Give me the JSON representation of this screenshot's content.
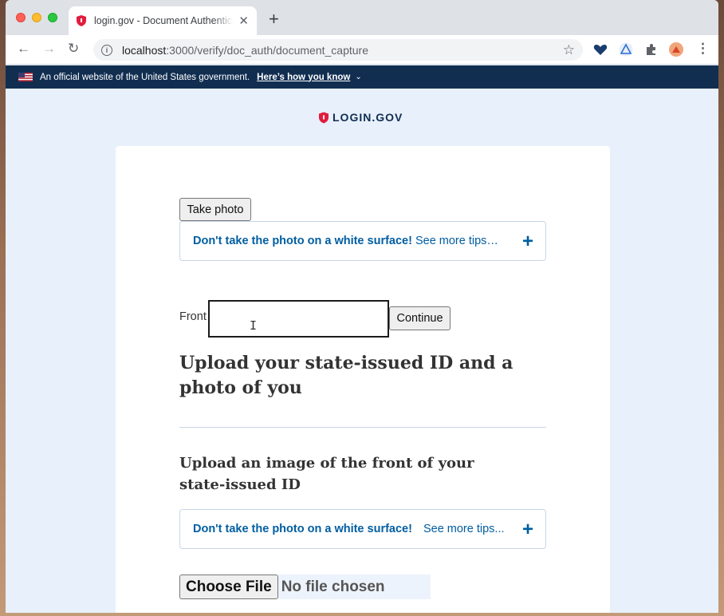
{
  "browser": {
    "tab_title": "login.gov - Document Authentication",
    "url_host": "localhost",
    "url_rest": ":3000/verify/doc_auth/document_capture"
  },
  "banner": {
    "text": "An official website of the United States government.",
    "link": "Here’s how you know"
  },
  "logo": {
    "text": "LOGIN.GOV"
  },
  "main": {
    "take_photo_label": "Take photo",
    "tips_top": {
      "strong": "Don't take the photo on a white surface!",
      "more": "See more tips…"
    },
    "front_label": "Front",
    "continue_label": "Continue",
    "heading": "Upload your state-issued ID and a photo of you",
    "subheading": "Upload an image of the front of your state-issued ID",
    "tips_bottom": {
      "strong": "Don't take the photo on a white surface!",
      "more": "See more tips..."
    },
    "choose_file_label": "Choose File",
    "file_status": "No file chosen"
  },
  "colors": {
    "banner": "#112e51",
    "link": "#005ea2",
    "brand_red": "#e21c3d"
  }
}
